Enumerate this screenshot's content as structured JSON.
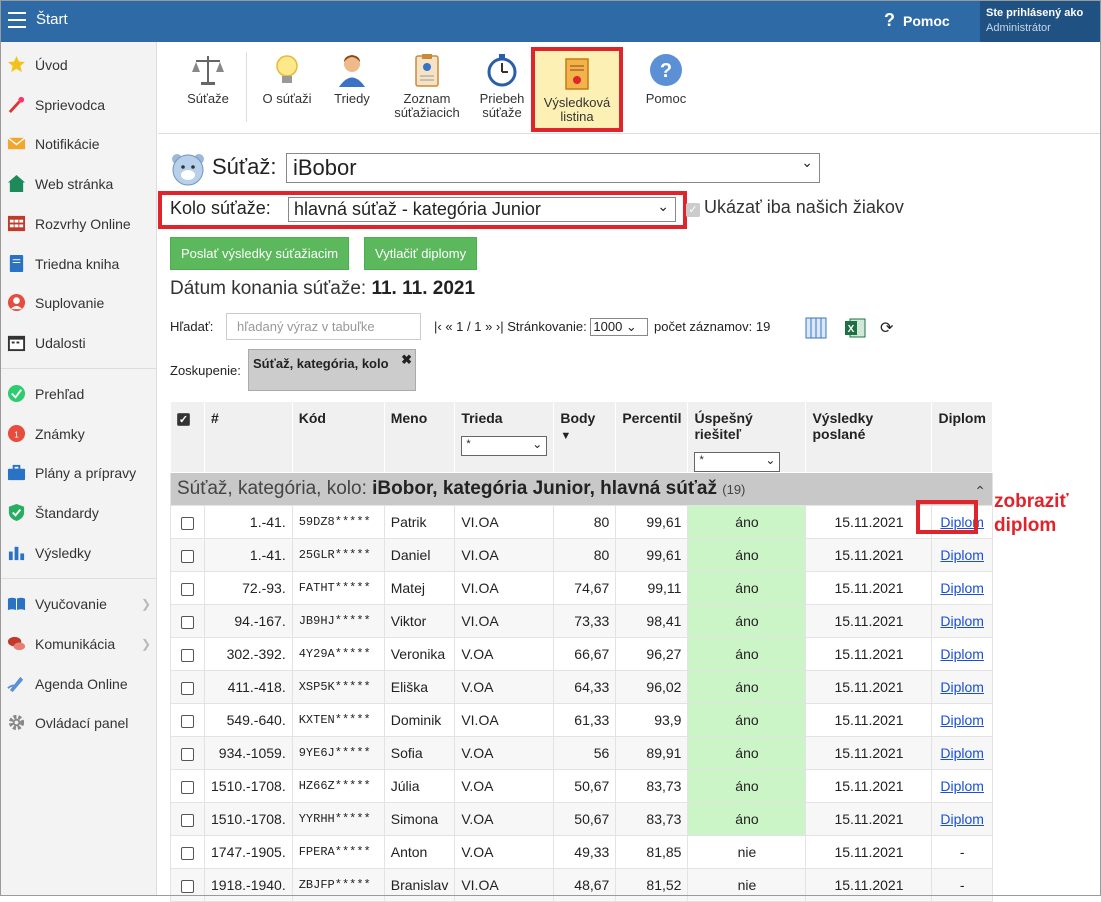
{
  "topbar": {
    "title": "Štart",
    "help": "Pomoc",
    "user_line1": "Ste prihlásený ako",
    "user_line2": "Administrátor"
  },
  "sidebar": {
    "items": [
      {
        "label": "Úvod",
        "icon": "star-icon"
      },
      {
        "label": "Sprievodca",
        "icon": "wand-icon"
      },
      {
        "label": "Notifikácie",
        "icon": "envelope-icon"
      },
      {
        "label": "Web stránka",
        "icon": "house-icon"
      },
      {
        "label": "Rozvrhy Online",
        "icon": "timetable-icon"
      },
      {
        "label": "Triedna kniha",
        "icon": "book-icon"
      },
      {
        "label": "Suplovanie",
        "icon": "person-icon"
      },
      {
        "label": "Udalosti",
        "icon": "calendar-icon"
      },
      {
        "label": "Prehľad",
        "icon": "check-circle-icon"
      },
      {
        "label": "Známky",
        "icon": "grade-icon"
      },
      {
        "label": "Plány a prípravy",
        "icon": "briefcase-icon"
      },
      {
        "label": "Štandardy",
        "icon": "shield-icon"
      },
      {
        "label": "Výsledky",
        "icon": "bar-chart-icon"
      },
      {
        "label": "Vyučovanie",
        "icon": "open-book-icon"
      },
      {
        "label": "Komunikácia",
        "icon": "chat-icon"
      },
      {
        "label": "Agenda Online",
        "icon": "pen-icon"
      },
      {
        "label": "Ovládací panel",
        "icon": "gear-icon"
      }
    ]
  },
  "toolbar": {
    "items": [
      {
        "label": "Súťaže",
        "icon": "scales-icon"
      },
      {
        "label": "O súťaži",
        "icon": "bulb-icon"
      },
      {
        "label": "Triedy",
        "icon": "student-icon"
      },
      {
        "label": "Zoznam súťažiacich",
        "icon": "clipboard-icon"
      },
      {
        "label": "Priebeh súťaže",
        "icon": "stopwatch-icon"
      },
      {
        "label": "Výsledková listina",
        "icon": "certificate-icon",
        "active": true
      },
      {
        "label": "Pomoc",
        "icon": "help-icon"
      }
    ]
  },
  "contest": {
    "label": "Súťaž:",
    "value": "iBobor",
    "round_label": "Kolo súťaže:",
    "round_value": "hlavná súťaž - kategória Junior",
    "only_ours": "Ukázať iba našich žiakov",
    "btn_send": "Poslať výsledky súťažiacim",
    "btn_print": "Vytlačiť diplomy",
    "date_label": "Dátum konania súťaže:",
    "date_value": "11. 11. 2021"
  },
  "search": {
    "label": "Hľadať:",
    "placeholder": "hľadaný výraz v tabuľke"
  },
  "pager": {
    "nav": "|‹ « 1 / 1 » ›|",
    "paging_label": "Stránkovanie:",
    "paging_value": "1000",
    "count_label": "počet záznamov: 19"
  },
  "grouping": {
    "label": "Zoskupenie:",
    "chip": "Súťaž, kategória, kolo",
    "close": "✖"
  },
  "table": {
    "headers": [
      "#",
      "Kód",
      "Meno",
      "Trieda",
      "Body",
      "Percentil",
      "Úspešný riešiteľ",
      "Výsledky poslané",
      "Diplom"
    ],
    "filter_value": "*",
    "sort_indicator": "▼",
    "group_prefix": "Súťaž, kategória, kolo:",
    "group_value": "iBobor, kategória Junior, hlavná súťaž",
    "group_count": "(19)",
    "rows": [
      {
        "rank": "1.-41.",
        "code": "59DZ8*****",
        "name": "Patrik",
        "cls": "VI.OA",
        "pts": "80",
        "pct": "99,61",
        "ok": "áno",
        "sent": "15.11.2021",
        "dip": "Diplom"
      },
      {
        "rank": "1.-41.",
        "code": "25GLR*****",
        "name": "Daniel",
        "cls": "VI.OA",
        "pts": "80",
        "pct": "99,61",
        "ok": "áno",
        "sent": "15.11.2021",
        "dip": "Diplom"
      },
      {
        "rank": "72.-93.",
        "code": "FATHT*****",
        "name": "Matej",
        "cls": "VI.OA",
        "pts": "74,67",
        "pct": "99,11",
        "ok": "áno",
        "sent": "15.11.2021",
        "dip": "Diplom"
      },
      {
        "rank": "94.-167.",
        "code": "JB9HJ*****",
        "name": "Viktor",
        "cls": "VI.OA",
        "pts": "73,33",
        "pct": "98,41",
        "ok": "áno",
        "sent": "15.11.2021",
        "dip": "Diplom"
      },
      {
        "rank": "302.-392.",
        "code": "4Y29A*****",
        "name": "Veronika",
        "cls": "V.OA",
        "pts": "66,67",
        "pct": "96,27",
        "ok": "áno",
        "sent": "15.11.2021",
        "dip": "Diplom"
      },
      {
        "rank": "411.-418.",
        "code": "XSP5K*****",
        "name": "Eliška",
        "cls": "V.OA",
        "pts": "64,33",
        "pct": "96,02",
        "ok": "áno",
        "sent": "15.11.2021",
        "dip": "Diplom"
      },
      {
        "rank": "549.-640.",
        "code": "KXTEN*****",
        "name": "Dominik",
        "cls": "VI.OA",
        "pts": "61,33",
        "pct": "93,9",
        "ok": "áno",
        "sent": "15.11.2021",
        "dip": "Diplom"
      },
      {
        "rank": "934.-1059.",
        "code": "9YE6J*****",
        "name": "Sofia",
        "cls": "V.OA",
        "pts": "56",
        "pct": "89,91",
        "ok": "áno",
        "sent": "15.11.2021",
        "dip": "Diplom"
      },
      {
        "rank": "1510.-1708.",
        "code": "HZ66Z*****",
        "name": "Júlia",
        "cls": "V.OA",
        "pts": "50,67",
        "pct": "83,73",
        "ok": "áno",
        "sent": "15.11.2021",
        "dip": "Diplom"
      },
      {
        "rank": "1510.-1708.",
        "code": "YYRHH*****",
        "name": "Simona",
        "cls": "V.OA",
        "pts": "50,67",
        "pct": "83,73",
        "ok": "áno",
        "sent": "15.11.2021",
        "dip": "Diplom"
      },
      {
        "rank": "1747.-1905.",
        "code": "FPERA*****",
        "name": "Anton",
        "cls": "V.OA",
        "pts": "49,33",
        "pct": "81,85",
        "ok": "nie",
        "sent": "15.11.2021",
        "dip": "-"
      },
      {
        "rank": "1918.-1940.",
        "code": "ZBJFP*****",
        "name": "Branislav",
        "cls": "VI.OA",
        "pts": "48,67",
        "pct": "81,52",
        "ok": "nie",
        "sent": "15.11.2021",
        "dip": "-"
      }
    ]
  },
  "annotation": {
    "line1": "zobraziť",
    "line2": "diplom"
  },
  "colors": {
    "topbar": "#2e6ba6",
    "accent_red": "#e0242b",
    "green_button": "#5cb85c",
    "success_cell": "#ccf5c7"
  }
}
